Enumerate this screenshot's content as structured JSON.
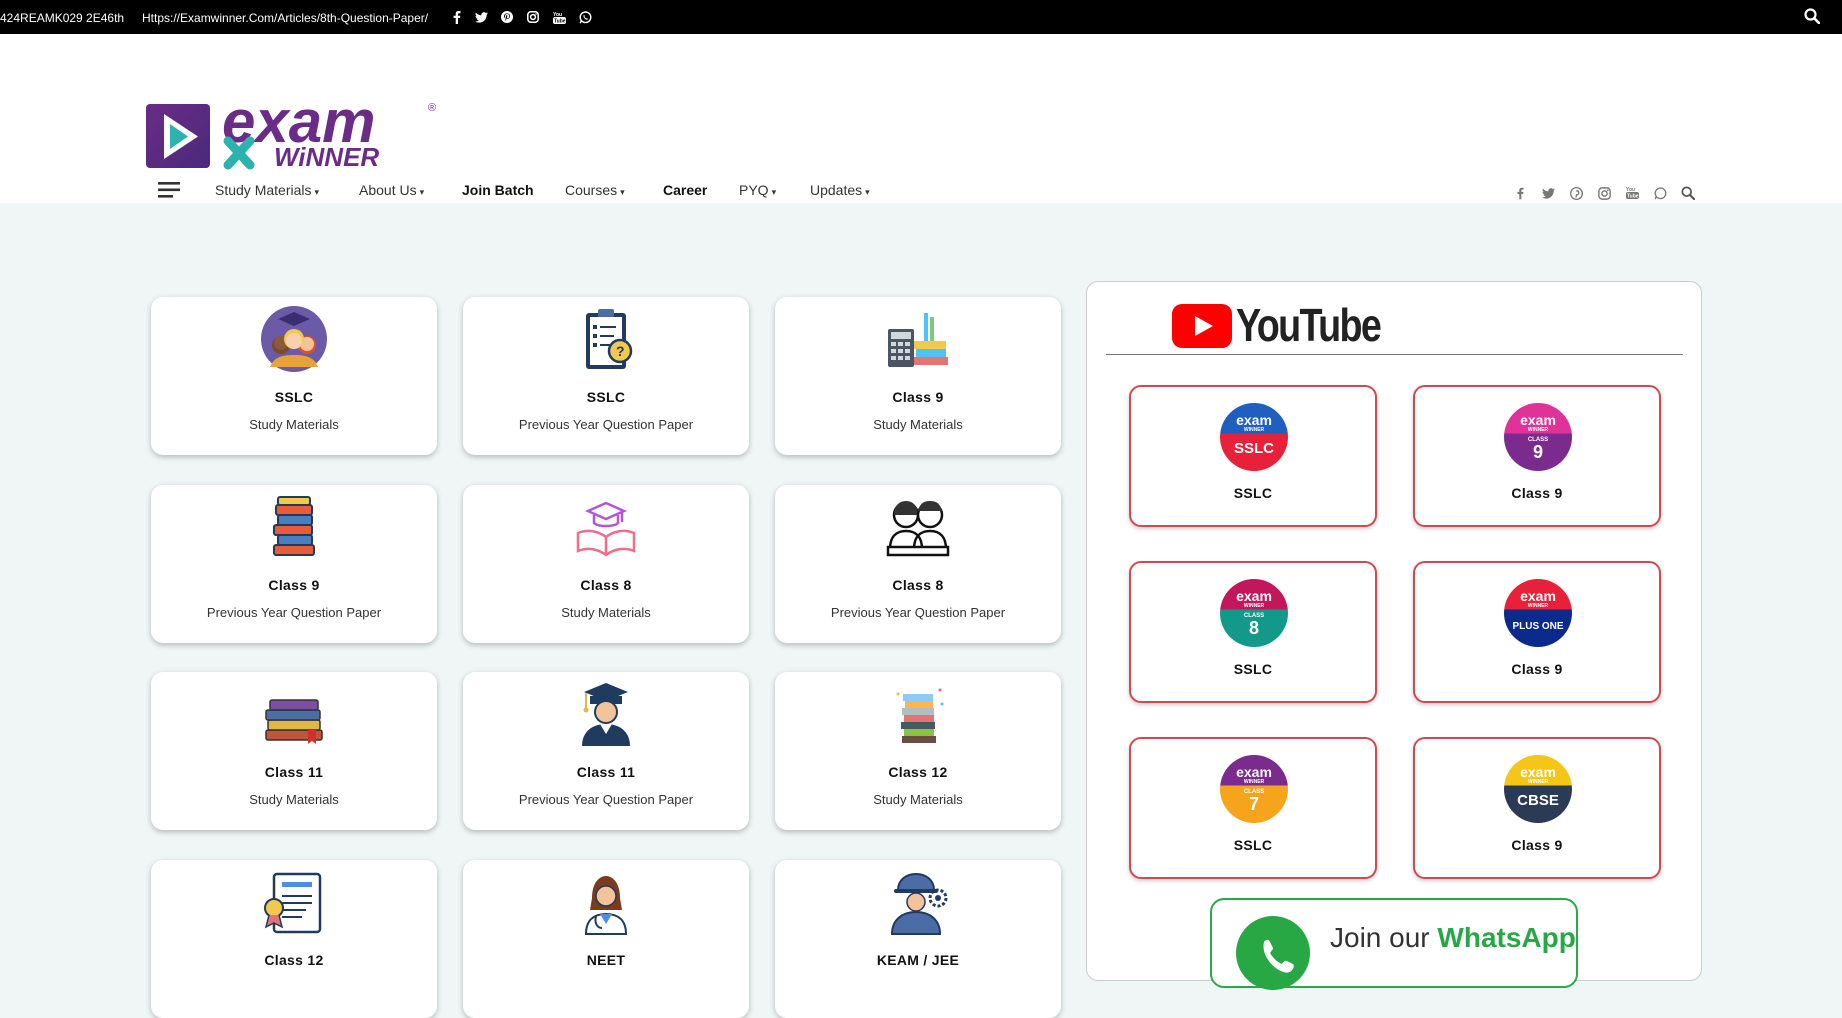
{
  "topbar": {
    "code": "424REAMK029 2E46th",
    "url": "Https://Examwinner.Com/Articles/8th-Question-Paper/",
    "social_icons": [
      "facebook-icon",
      "twitter-icon",
      "pinterest-icon",
      "instagram-icon",
      "youtube-icon",
      "whatsapp-icon"
    ],
    "search_icon": "search-icon"
  },
  "logo": {
    "line1": "exam",
    "line2": "WiNNER",
    "mark": "®"
  },
  "nav": {
    "items": [
      {
        "label": "Study Materials",
        "dropdown": true
      },
      {
        "label": "About Us",
        "dropdown": true
      },
      {
        "label": "Join Batch",
        "dropdown": false
      },
      {
        "label": "Courses",
        "dropdown": true
      },
      {
        "label": "Career",
        "dropdown": false
      },
      {
        "label": "PYQ",
        "dropdown": true
      },
      {
        "label": "Updates",
        "dropdown": true
      }
    ],
    "caret": "▾"
  },
  "cards": [
    {
      "title": "SSLC",
      "subtitle": "Study Materials",
      "icon": "students-group-icon"
    },
    {
      "title": "SSLC",
      "subtitle": "Previous Year Question Paper",
      "icon": "clipboard-question-icon"
    },
    {
      "title": "Class 9",
      "subtitle": "Study Materials",
      "icon": "books-calculator-icon"
    },
    {
      "title": "Class 9",
      "subtitle": "Previous Year Question Paper",
      "icon": "book-stack-icon"
    },
    {
      "title": "Class 8",
      "subtitle": "Study Materials",
      "icon": "graduation-book-icon"
    },
    {
      "title": "Class 8",
      "subtitle": "Previous Year Question Paper",
      "icon": "students-desk-icon"
    },
    {
      "title": "Class 11",
      "subtitle": "Study Materials",
      "icon": "books-icon"
    },
    {
      "title": "Class 11",
      "subtitle": "Previous Year Question Paper",
      "icon": "graduate-icon"
    },
    {
      "title": "Class 12",
      "subtitle": "Study Materials",
      "icon": "book-pile-icon"
    },
    {
      "title": "Class 12",
      "subtitle": "",
      "icon": "certificate-icon"
    },
    {
      "title": "NEET",
      "subtitle": "",
      "icon": "doctor-icon"
    },
    {
      "title": "KEAM / JEE",
      "subtitle": "",
      "icon": "engineer-icon"
    }
  ],
  "youtube": {
    "heading": "YouTube",
    "channels": [
      {
        "label": "SSLC",
        "badge_top": "exam",
        "badge_sub": "WINNER",
        "badge_main": "SSLC",
        "badge_class": "",
        "colors": [
          "#1f5fbf",
          "#e8213a"
        ]
      },
      {
        "label": "Class 9",
        "badge_top": "exam",
        "badge_sub": "WINNER",
        "badge_main": "9",
        "badge_class": "CLASS",
        "colors": [
          "#e0339a",
          "#7b2a8e"
        ]
      },
      {
        "label": "SSLC",
        "badge_top": "exam",
        "badge_sub": "WINNER",
        "badge_main": "8",
        "badge_class": "CLASS",
        "colors": [
          "#c2185b",
          "#12998a"
        ]
      },
      {
        "label": "Class 9",
        "badge_top": "exam",
        "badge_sub": "WINNER",
        "badge_main": "PLUS ONE",
        "badge_class": "",
        "colors": [
          "#e8213a",
          "#0b2a8a"
        ]
      },
      {
        "label": "SSLC",
        "badge_top": "exam",
        "badge_sub": "WINNER",
        "badge_main": "7",
        "badge_class": "CLASS",
        "colors": [
          "#7b2a8e",
          "#f7a41d"
        ]
      },
      {
        "label": "Class 9",
        "badge_top": "exam",
        "badge_sub": "WINNER",
        "badge_main": "CBSE",
        "badge_class": "",
        "colors": [
          "#f5c518",
          "#2b3a55"
        ]
      }
    ]
  },
  "whatsapp": {
    "prefix": "Join our ",
    "brand": "WhatsApp"
  }
}
